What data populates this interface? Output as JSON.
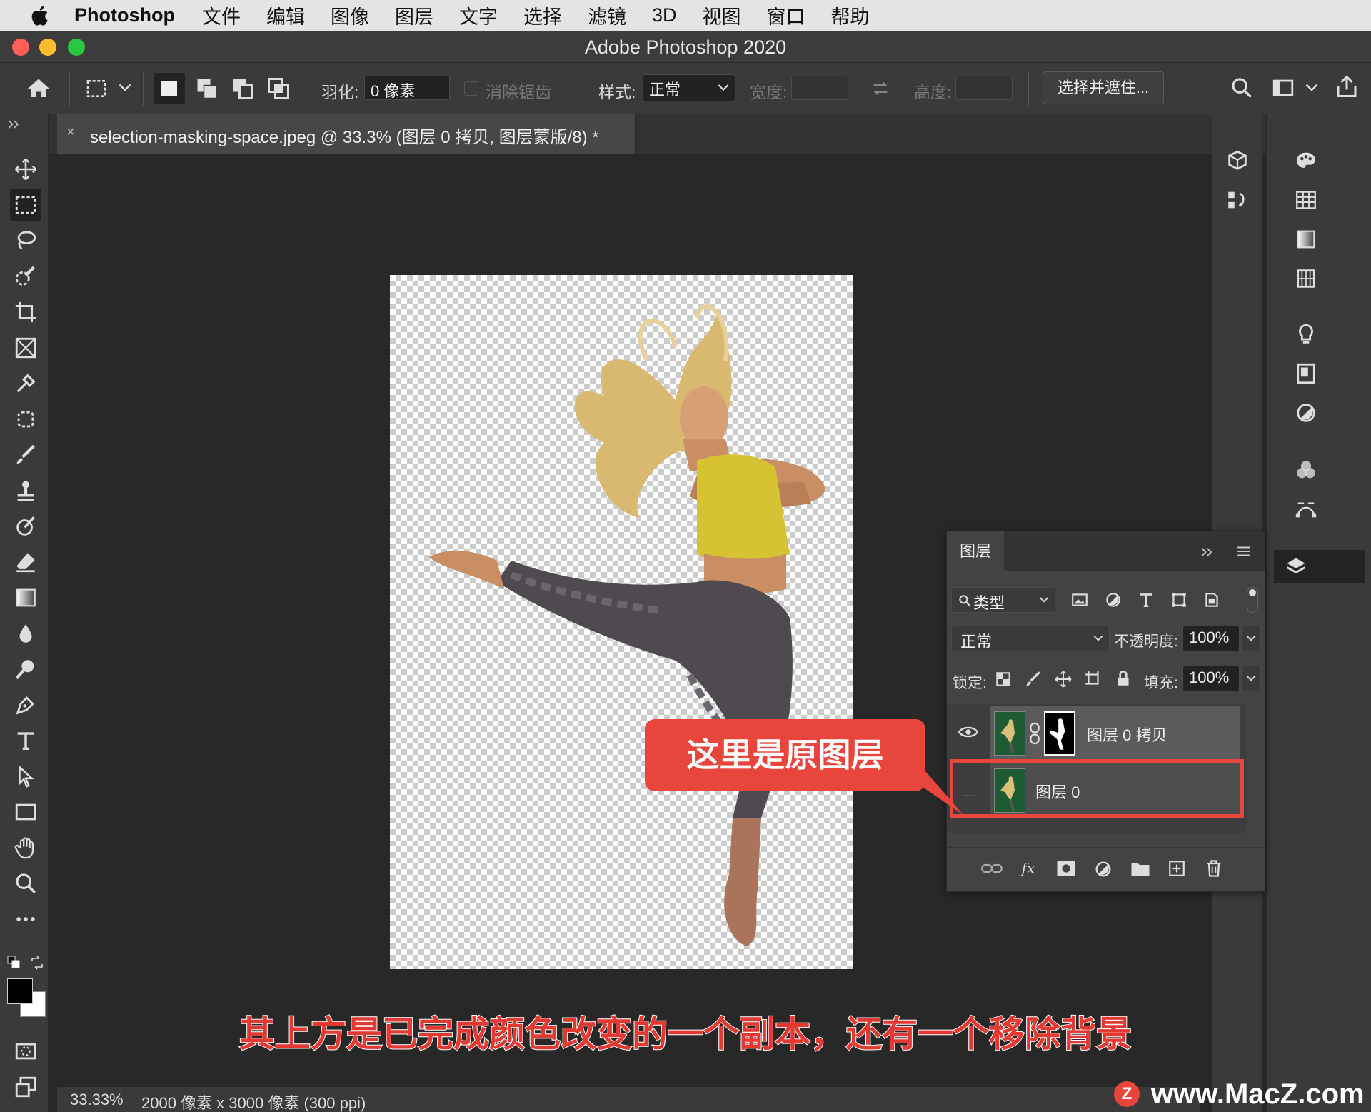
{
  "menubar": {
    "app_name": "Photoshop",
    "items": [
      "文件",
      "编辑",
      "图像",
      "图层",
      "文字",
      "选择",
      "滤镜",
      "3D",
      "视图",
      "窗口",
      "帮助"
    ]
  },
  "window": {
    "title": "Adobe Photoshop 2020"
  },
  "options": {
    "feather_label": "羽化:",
    "feather_value": "0 像素",
    "antialias_label": "消除锯齿",
    "style_label": "样式:",
    "style_value": "正常",
    "width_label": "宽度:",
    "height_label": "高度:",
    "select_mask_label": "选择并遮住..."
  },
  "document": {
    "tab_title": "selection-masking-space.jpeg @ 33.3% (图层 0 拷贝, 图层蒙版/8) *",
    "close_glyph": "×"
  },
  "layers_panel": {
    "tab_label": "图层",
    "filter_label": "类型",
    "blend_mode": "正常",
    "opacity_label": "不透明度:",
    "opacity_value": "100%",
    "lock_label": "锁定:",
    "fill_label": "填充:",
    "fill_value": "100%",
    "layers": [
      {
        "name": "图层 0 拷贝",
        "visible": true,
        "has_mask": true
      },
      {
        "name": "图层 0",
        "visible": false,
        "has_mask": false
      }
    ]
  },
  "annotations": {
    "callout": "这里是原图层",
    "caption": "其上方是已完成颜色改变的一个副本，还有一个移除背景"
  },
  "status": {
    "zoom": "33.33%",
    "doc_info": "2000 像素 x 3000 像素 (300 ppi)"
  },
  "watermark": "www.MacZ.com",
  "colors": {
    "accent_red": "#e8453c",
    "panel_bg": "#434343",
    "canvas_bg": "#282828"
  }
}
